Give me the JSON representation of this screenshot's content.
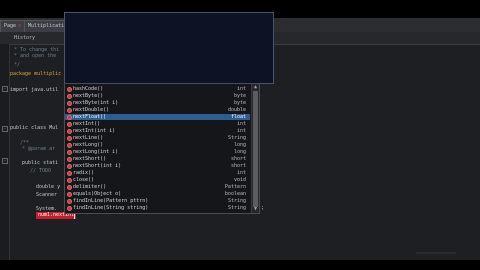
{
  "tabs": [
    {
      "label": "Page",
      "close": "x"
    },
    {
      "label": "Multiplicati...",
      "close": "x"
    }
  ],
  "toolbar": {
    "history_label": "History"
  },
  "code_lines": [
    {
      "text": "* To change thi",
      "cls": "cm"
    },
    {
      "text": "* and open the",
      "cls": "cm"
    },
    {
      "text": "*/",
      "cls": "cm"
    },
    {
      "text": "package multiplic",
      "cls": "kw"
    },
    {
      "text": "import java.util",
      "cls": ""
    },
    {
      "text": "public class Mul",
      "cls": ""
    },
    {
      "text": "/**",
      "cls": "cm"
    },
    {
      "text": "* @param ar",
      "cls": "cm"
    },
    {
      "text": "public stati",
      "cls": ""
    },
    {
      "text": "// TODO",
      "cls": "cm"
    },
    {
      "text": "double y",
      "cls": ""
    },
    {
      "text": "Scanner",
      "cls": ""
    },
    {
      "text": "System.",
      "cls": ""
    }
  ],
  "current_line": {
    "text": "num1.nextInt",
    "trailing": ");"
  },
  "autocomplete": {
    "items": [
      {
        "sig": "hashCode()",
        "ret": "int",
        "selected": false
      },
      {
        "sig": "nextByte()",
        "ret": "byte",
        "selected": false
      },
      {
        "sig": "nextByte(int i)",
        "ret": "byte",
        "selected": false
      },
      {
        "sig": "nextDouble()",
        "ret": "double",
        "selected": false
      },
      {
        "sig": "nextFloat()",
        "ret": "float",
        "selected": true
      },
      {
        "sig": "nextInt()",
        "ret": "int",
        "selected": false
      },
      {
        "sig": "nextInt(int i)",
        "ret": "int",
        "selected": false
      },
      {
        "sig": "nextLine()",
        "ret": "String",
        "selected": false
      },
      {
        "sig": "nextLong()",
        "ret": "long",
        "selected": false
      },
      {
        "sig": "nextLong(int i)",
        "ret": "long",
        "selected": false
      },
      {
        "sig": "nextShort()",
        "ret": "short",
        "selected": false
      },
      {
        "sig": "nextShort(int i)",
        "ret": "short",
        "selected": false
      },
      {
        "sig": "radix()",
        "ret": "int",
        "selected": false
      },
      {
        "sig": "close()",
        "ret": "void",
        "selected": false
      },
      {
        "sig": "delimiter()",
        "ret": "Pattern",
        "selected": false
      },
      {
        "sig": "equals(Object o)",
        "ret": "boolean",
        "selected": false
      },
      {
        "sig": "findInLine(Pattern pttrn)",
        "ret": "String",
        "selected": false
      },
      {
        "sig": "findInLine(String string)",
        "ret": "String",
        "selected": false
      }
    ],
    "scroll_up": "▲",
    "scroll_down": "▼"
  },
  "colors": {
    "selection": "#2f5d8f",
    "highlight": "#c31f2c",
    "doc_popup": "#0c1324"
  }
}
